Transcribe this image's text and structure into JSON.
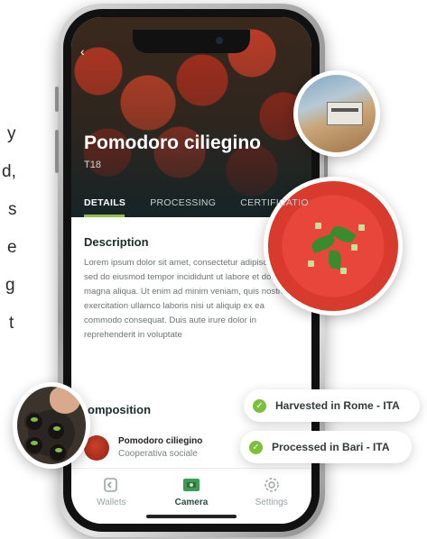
{
  "side_text_fragments": [
    "y",
    "d,",
    "s",
    "e",
    "g",
    "t"
  ],
  "product": {
    "title": "Pomodoro ciliegino",
    "code": "T18"
  },
  "tabs": [
    {
      "label": "DETAILS",
      "active": true
    },
    {
      "label": "PROCESSING",
      "active": false
    },
    {
      "label": "CERTIFICATIO",
      "active": false
    }
  ],
  "description": {
    "heading": "Description",
    "text": "Lorem ipsum dolor sit amet, consectetur adipiscing elit, sed do eiusmod tempor incididunt ut labore et dolore magna aliqua. Ut enim ad minim veniam, quis nostrud exercitation ullamco laboris nisi ut aliquip ex ea commodo consequat. Duis aute irure dolor in reprehenderit in voluptate"
  },
  "composition": {
    "heading": "omposition",
    "item": {
      "name": "Pomodoro ciliegino",
      "organization": "Cooperativa sociale"
    }
  },
  "bottom_nav": [
    {
      "label": "Wallets",
      "icon": "wallet-icon",
      "active": false
    },
    {
      "label": "Camera",
      "icon": "camera-icon",
      "active": true
    },
    {
      "label": "Settings",
      "icon": "settings-gear-icon",
      "active": false
    }
  ],
  "badges": [
    {
      "text": "Harvested in Rome - ITA",
      "icon": "check-circle-icon"
    },
    {
      "text": "Processed in Bari - ITA",
      "icon": "check-circle-icon"
    }
  ],
  "colors": {
    "accent_green": "#8fc14a",
    "check_green": "#7cbf3c",
    "dark_teal": "#2c4a46"
  }
}
